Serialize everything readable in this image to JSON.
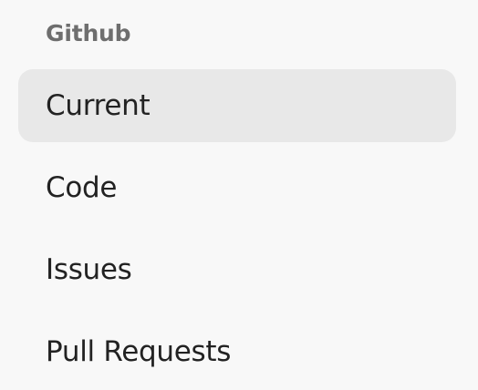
{
  "section": {
    "title": "Github"
  },
  "items": [
    {
      "label": "Current",
      "selected": true
    },
    {
      "label": "Code",
      "selected": false
    },
    {
      "label": "Issues",
      "selected": false
    },
    {
      "label": "Pull Requests",
      "selected": false
    }
  ],
  "colors": {
    "background": "#f8f8f8",
    "selected_background": "#e8e8e8",
    "header_text": "#6e6e6e",
    "item_text": "#222222"
  }
}
